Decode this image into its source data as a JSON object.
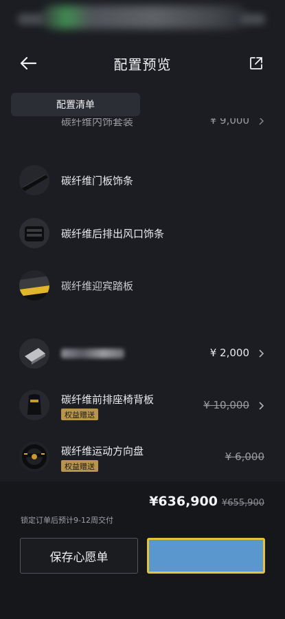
{
  "header": {
    "title": "配置预览"
  },
  "tabs": [
    {
      "label": "配置清单"
    },
    {
      "label": ""
    }
  ],
  "items": [
    {
      "name": "碳纤维内饰套装",
      "price": "¥ 9,000",
      "strikethrough": false,
      "chevron": true,
      "badge": ""
    },
    {
      "name": "碳纤维门板饰条",
      "price": "",
      "strikethrough": false,
      "chevron": false,
      "badge": ""
    },
    {
      "name": "碳纤维后排出风口饰条",
      "price": "",
      "strikethrough": false,
      "chevron": false,
      "badge": ""
    },
    {
      "name": "碳纤维迎宾踏板",
      "price": "",
      "strikethrough": false,
      "chevron": false,
      "badge": ""
    },
    {
      "name": "",
      "price": "¥ 2,000",
      "strikethrough": false,
      "chevron": true,
      "badge": ""
    },
    {
      "name": "碳纤维前排座椅背板",
      "price": "¥ 10,000",
      "strikethrough": true,
      "chevron": true,
      "badge": "权益赠送"
    },
    {
      "name": "碳纤维运动方向盘",
      "price": "¥ 6,000",
      "strikethrough": true,
      "chevron": false,
      "badge": "权益赠送"
    }
  ],
  "summary": {
    "total_price": "¥636,900",
    "original_price": "¥655,900",
    "delivery_note": "锁定订单后预计9-12周交付"
  },
  "buttons": {
    "wishlist_label": "保存心愿单",
    "primary_label": ""
  },
  "colors": {
    "background": "#1b1d22",
    "badge": "#b9944d",
    "primary_button": "#5b97cf",
    "primary_border": "#e4c43a"
  }
}
